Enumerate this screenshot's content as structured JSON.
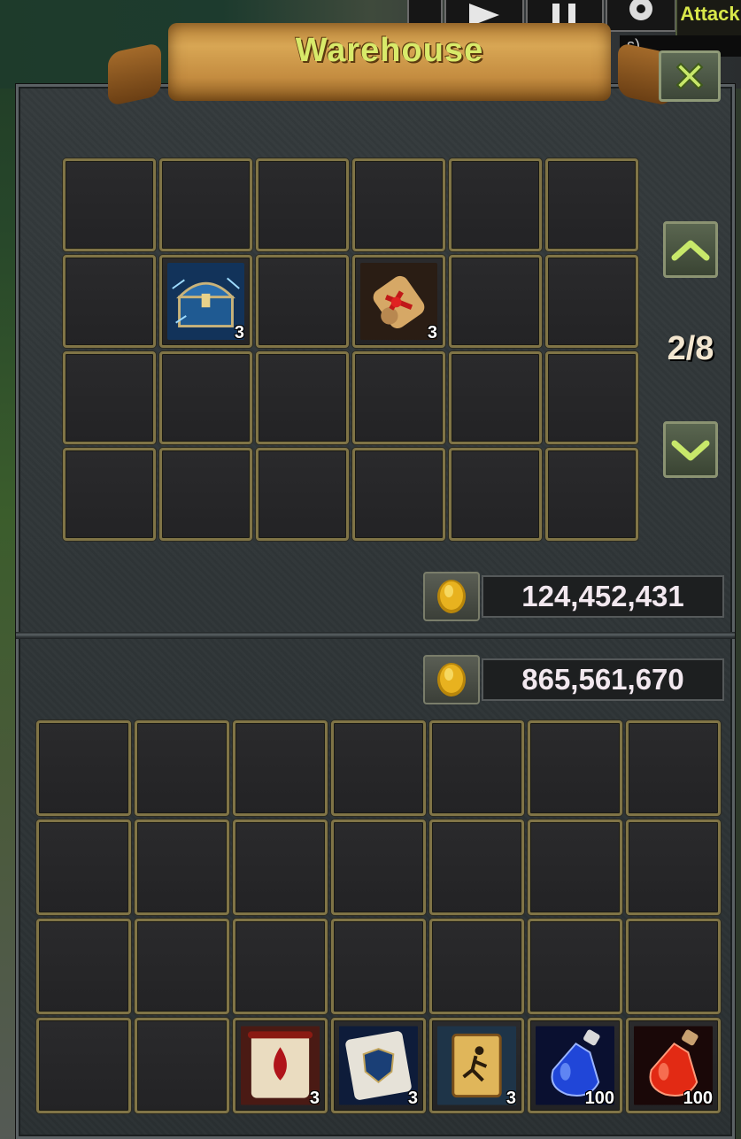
{
  "header": {
    "title": "Warehouse",
    "attack_label": "Attack",
    "sub_text": "s)"
  },
  "pagination": {
    "label": "2/8",
    "up_icon": "chevron-up-icon",
    "down_icon": "chevron-down-icon"
  },
  "warehouse": {
    "gold_amount": "124,452,431",
    "slots": [
      {},
      {},
      {},
      {},
      {},
      {},
      {},
      {
        "item": "blue-treasure-chest-icon",
        "count": "3"
      },
      {},
      {
        "item": "red-ribbon-scroll-icon",
        "count": "3"
      },
      {},
      {},
      {},
      {},
      {},
      {},
      {},
      {},
      {},
      {},
      {},
      {},
      {},
      {}
    ]
  },
  "inventory": {
    "gold_amount": "865,561,670",
    "slots": [
      {},
      {},
      {},
      {},
      {},
      {},
      {},
      {},
      {},
      {},
      {},
      {},
      {},
      {},
      {},
      {},
      {},
      {},
      {},
      {},
      {},
      {},
      {},
      {
        "item": "red-blood-drop-scroll-icon",
        "count": "3"
      },
      {
        "item": "blue-shield-scroll-icon",
        "count": "3"
      },
      {
        "item": "golden-rune-scroll-icon",
        "count": "3"
      },
      {
        "item": "blue-mana-potion-icon",
        "count": "100"
      },
      {
        "item": "red-health-potion-icon",
        "count": "100"
      }
    ]
  },
  "colors": {
    "title": "#d8ea6a",
    "slot_border": "#807446",
    "gold_text": "#f2e8ef"
  }
}
